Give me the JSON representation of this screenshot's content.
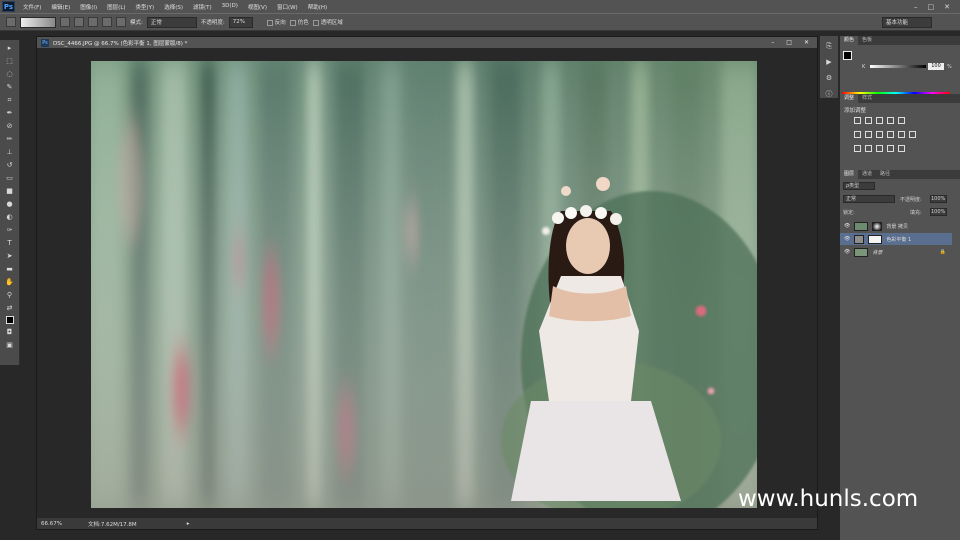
{
  "app": {
    "logo": "Ps"
  },
  "menubar": {
    "items": [
      "文件(F)",
      "编辑(E)",
      "图像(I)",
      "图层(L)",
      "类型(Y)",
      "选择(S)",
      "滤镜(T)",
      "3D(D)",
      "视图(V)",
      "窗口(W)",
      "帮助(H)"
    ],
    "min": "–",
    "max": "□",
    "close": "✕"
  },
  "options": {
    "mode_label": "模式:",
    "mode_value": "正常",
    "opacity_label": "不透明度:",
    "opacity_value": "72%",
    "reverse": "反向",
    "dither": "仿色",
    "transparency": "透明区域",
    "workspace": "基本功能"
  },
  "document": {
    "title": "DSC_4466.JPG @ 66.7% (色彩平衡 1, 图层蒙版/8) *",
    "zoom": "66.67%",
    "doc_info": "文档:7.62M/17.8M"
  },
  "color_panel": {
    "tabs": [
      "颜色",
      "色板"
    ],
    "k_label": "K",
    "k_value": "100",
    "percent": "%"
  },
  "adjust_panel": {
    "tabs": [
      "调整",
      "样式"
    ],
    "title": "添加调整"
  },
  "layers_panel": {
    "tabs": [
      "图层",
      "通道",
      "路径"
    ],
    "filter": "ρ类型",
    "blend": "正常",
    "opacity_label": "不透明度:",
    "opacity_value": "100%",
    "lock_label": "锁定:",
    "fill_label": "填充:",
    "fill_value": "100%",
    "layers": [
      {
        "name": "背景 拷贝",
        "selected": false
      },
      {
        "name": "色彩平衡 1",
        "selected": true
      },
      {
        "name": "背景",
        "selected": false
      }
    ]
  },
  "watermark": "www.hunls.com",
  "colors": {
    "chrome": "#535353",
    "workspace": "#282828",
    "selection": "#5a6e8f"
  }
}
